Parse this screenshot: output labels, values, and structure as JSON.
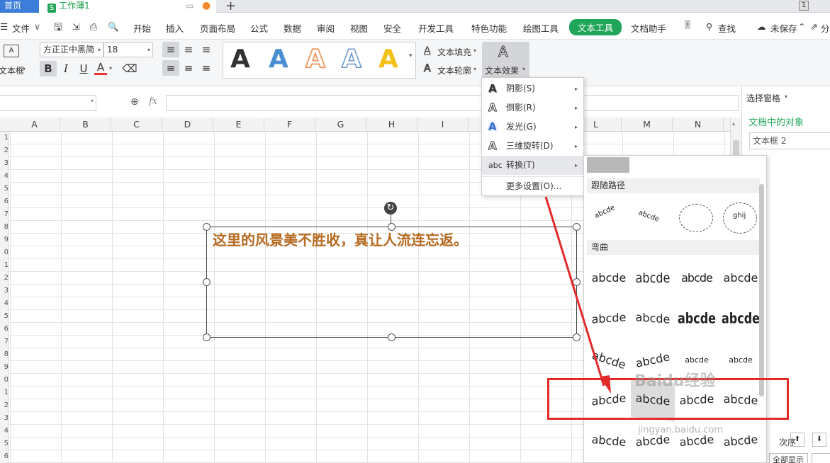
{
  "tabs": {
    "home": "首页",
    "workbook": "工作薄1",
    "workbook_icon_letter": "S",
    "add": "+",
    "page_count": "1"
  },
  "menu": {
    "file": "文件",
    "items": [
      "开始",
      "插入",
      "页面布局",
      "公式",
      "数据",
      "审阅",
      "视图",
      "安全",
      "开发工具",
      "特色功能",
      "绘图工具",
      "文本工具",
      "文档助手"
    ],
    "active": "文本工具",
    "search": "查找",
    "unsaved": "未保存",
    "share": "分"
  },
  "ribbon": {
    "textbox_label": "文本框",
    "font_name": "方正正中黑简",
    "font_size": "18",
    "fill_label": "文本填充",
    "outline_label": "文本轮廓",
    "effect_label": "文本效果",
    "gallery": [
      {
        "glyph": "A",
        "color": "#000000"
      },
      {
        "glyph": "A",
        "color": "#4a8fd4"
      },
      {
        "glyph": "A",
        "color": "#f0b48a"
      },
      {
        "glyph": "A",
        "color": "#dde8f4"
      },
      {
        "glyph": "A",
        "color": "#f3c118"
      }
    ]
  },
  "formula_bar": {
    "fx": "fx"
  },
  "columns": [
    "A",
    "B",
    "C",
    "D",
    "E",
    "F",
    "G",
    "H",
    "I",
    "J",
    "K",
    "L",
    "M",
    "N"
  ],
  "rows": [
    "1",
    "2",
    "3",
    "4",
    "5",
    "6",
    "7",
    "8",
    "9",
    "0",
    "1",
    "2",
    "3",
    "4",
    "5",
    "6",
    "7",
    "8",
    "9",
    "0",
    "1",
    "2",
    "3",
    "4",
    "5",
    "6"
  ],
  "textbox": {
    "content": "这里的风景美不胜收，真让人流连忘返。"
  },
  "effect_menu": [
    {
      "label": "阴影(S)",
      "has_sub": true
    },
    {
      "label": "倒影(R)",
      "has_sub": true
    },
    {
      "label": "发光(G)",
      "has_sub": true
    },
    {
      "label": "三维旋转(D)",
      "has_sub": true
    },
    {
      "label": "转换(T)",
      "has_sub": true,
      "icon": "abc"
    },
    {
      "label": "更多设置(O)...",
      "has_sub": false
    }
  ],
  "transform_panel": {
    "follow_path": "跟随路径",
    "warp": "弯曲",
    "sample": "abcde"
  },
  "side_pane": {
    "title": "选择窗格",
    "objects_heading": "文档中的对象",
    "object": "文本框 2",
    "order": "次序",
    "show_all": "全部显示"
  },
  "watermark": "Baidu经验",
  "watermark_url": "jingyan.baidu.com",
  "colors": {
    "accent_green": "#21a55a",
    "highlight_red": "#e32a2a",
    "text_orange": "#b5691f"
  }
}
